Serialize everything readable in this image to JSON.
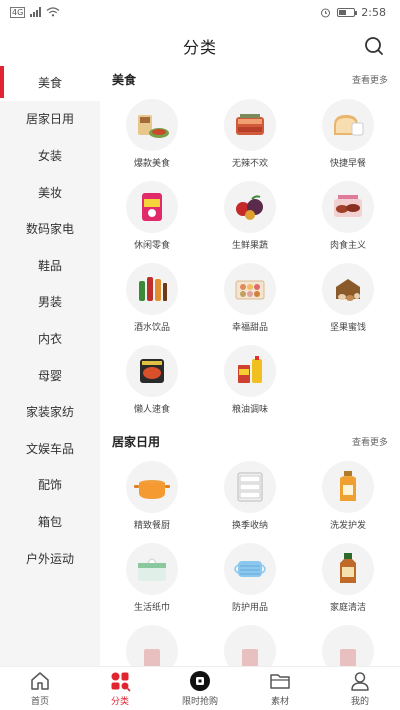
{
  "status_bar": {
    "network": "4G",
    "time": "2:58"
  },
  "header": {
    "title": "分类"
  },
  "sidebar": {
    "items": [
      {
        "label": "美食"
      },
      {
        "label": "居家日用"
      },
      {
        "label": "女装"
      },
      {
        "label": "美妆"
      },
      {
        "label": "数码家电"
      },
      {
        "label": "鞋品"
      },
      {
        "label": "男装"
      },
      {
        "label": "内衣"
      },
      {
        "label": "母婴"
      },
      {
        "label": "家装家纺"
      },
      {
        "label": "文娱车品"
      },
      {
        "label": "配饰"
      },
      {
        "label": "箱包"
      },
      {
        "label": "户外运动"
      }
    ],
    "active_index": 0
  },
  "sections": [
    {
      "title": "美食",
      "more": "查看更多",
      "items": [
        {
          "label": "爆款美食",
          "icon": "snack-plate-icon"
        },
        {
          "label": "无辣不欢",
          "icon": "spicy-meat-icon"
        },
        {
          "label": "快捷早餐",
          "icon": "bread-icon"
        },
        {
          "label": "休闲零食",
          "icon": "chips-bag-icon"
        },
        {
          "label": "生鲜果蔬",
          "icon": "fruit-icon"
        },
        {
          "label": "肉食主义",
          "icon": "sausage-icon"
        },
        {
          "label": "酒水饮品",
          "icon": "bottles-icon"
        },
        {
          "label": "幸福甜品",
          "icon": "dessert-box-icon"
        },
        {
          "label": "坚果蜜饯",
          "icon": "nuts-icon"
        },
        {
          "label": "懒人速食",
          "icon": "instant-noodle-icon"
        },
        {
          "label": "粮油调味",
          "icon": "cooking-oil-icon"
        }
      ]
    },
    {
      "title": "居家日用",
      "more": "查看更多",
      "items": [
        {
          "label": "精致餐厨",
          "icon": "pot-icon"
        },
        {
          "label": "换季收纳",
          "icon": "storage-drawer-icon"
        },
        {
          "label": "洗发护发",
          "icon": "shampoo-bottle-icon"
        },
        {
          "label": "生活纸巾",
          "icon": "tissue-icon"
        },
        {
          "label": "防护用品",
          "icon": "face-mask-icon"
        },
        {
          "label": "家庭清洁",
          "icon": "disinfectant-bottle-icon"
        },
        {
          "label": "",
          "icon": "partial-item-icon"
        },
        {
          "label": "",
          "icon": "partial-item-icon"
        },
        {
          "label": "",
          "icon": "partial-item-icon"
        }
      ]
    }
  ],
  "tabbar": {
    "items": [
      {
        "label": "首页",
        "icon": "home-icon"
      },
      {
        "label": "分类",
        "icon": "category-icon"
      },
      {
        "label": "限时抢购",
        "icon": "flash-sale-icon"
      },
      {
        "label": "素材",
        "icon": "folder-icon"
      },
      {
        "label": "我的",
        "icon": "profile-icon"
      }
    ],
    "active_index": 1
  },
  "colors": {
    "accent": "#e02430",
    "sidebar_bg": "#f5f5f5",
    "thumb_bg": "#f3f3f3"
  }
}
